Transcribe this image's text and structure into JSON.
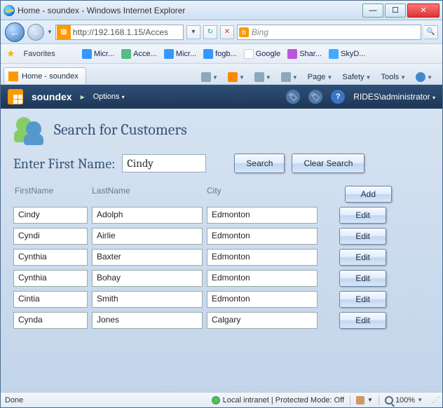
{
  "window": {
    "title": "Home - soundex - Windows Internet Explorer"
  },
  "nav": {
    "url": "http://192.168.1.15/Acces",
    "search_engine": "Bing"
  },
  "favorites": {
    "label": "Favorites",
    "links": [
      {
        "label": "Micr..."
      },
      {
        "label": "Acce..."
      },
      {
        "label": "Micr..."
      },
      {
        "label": "fogb..."
      },
      {
        "label": "Google"
      },
      {
        "label": "Shar..."
      },
      {
        "label": "SkyD..."
      }
    ]
  },
  "tab": {
    "label": "Home - soundex"
  },
  "commands": {
    "page": "Page",
    "safety": "Safety",
    "tools": "Tools"
  },
  "app": {
    "name": "soundex",
    "options": "Options",
    "user": "RIDES\\administrator"
  },
  "page": {
    "title": "Search for Customers",
    "search_label": "Enter First Name:",
    "search_value": "Cindy",
    "btn_search": "Search",
    "btn_clear": "Clear Search",
    "btn_add": "Add",
    "btn_edit": "Edit",
    "columns": {
      "first": "FirstName",
      "last": "LastName",
      "city": "City"
    },
    "rows": [
      {
        "first": "Cindy",
        "last": "Adolph",
        "city": "Edmonton"
      },
      {
        "first": "Cyndi",
        "last": "Airlie",
        "city": "Edmonton"
      },
      {
        "first": "Cynthia",
        "last": "Baxter",
        "city": "Edmonton"
      },
      {
        "first": "Cynthia",
        "last": "Bohay",
        "city": "Edmonton"
      },
      {
        "first": "Cintia",
        "last": "Smith",
        "city": "Edmonton"
      },
      {
        "first": "Cynda",
        "last": "Jones",
        "city": "Calgary"
      }
    ]
  },
  "status": {
    "left": "Done",
    "zone": "Local intranet | Protected Mode: Off",
    "zoom": "100%"
  }
}
